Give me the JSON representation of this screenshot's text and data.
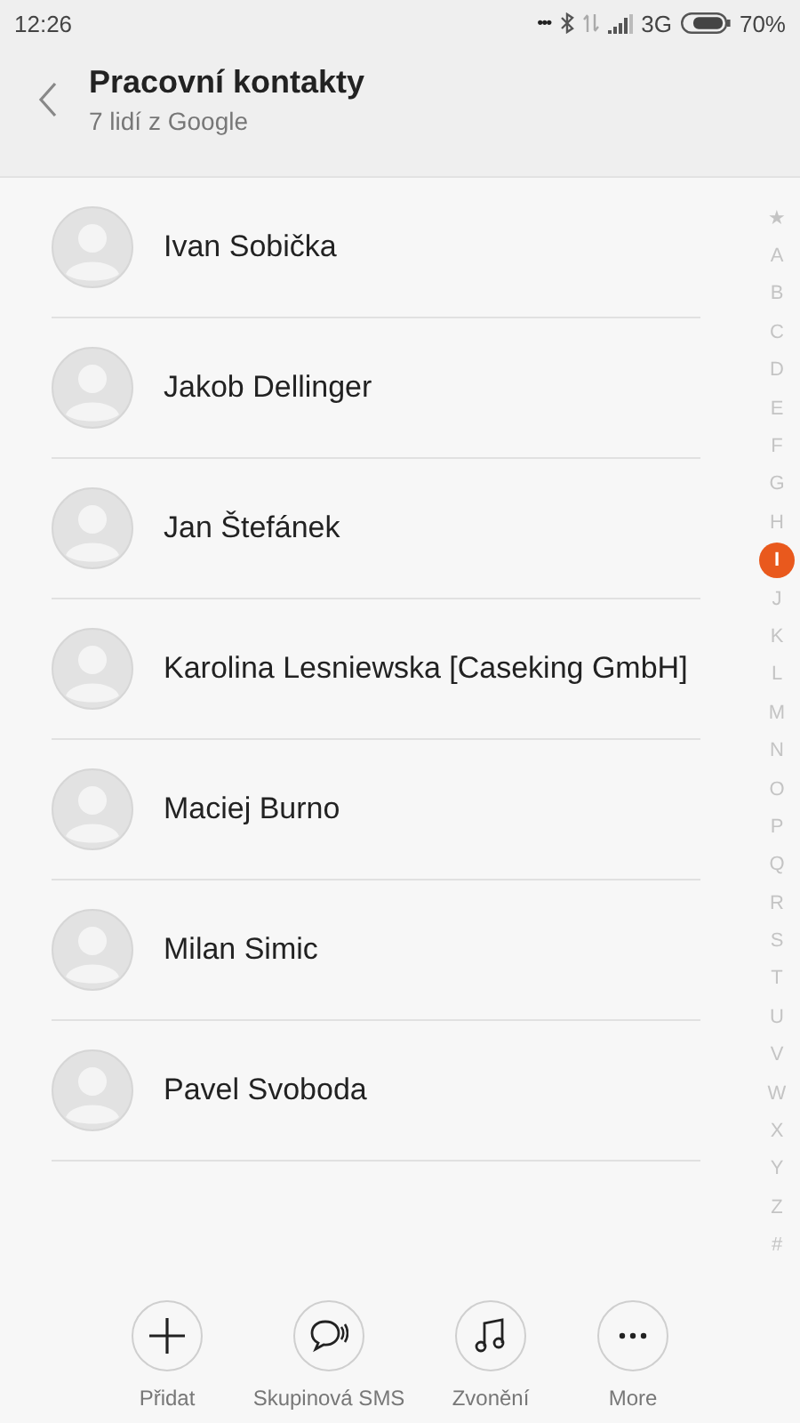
{
  "status_bar": {
    "time": "12:26",
    "dots": "•••",
    "network": "3G",
    "battery": "70%"
  },
  "header": {
    "title": "Pracovní kontakty",
    "subtitle": "7 lidí z Google"
  },
  "contacts": [
    {
      "name": "Ivan Sobička"
    },
    {
      "name": "Jakob Dellinger"
    },
    {
      "name": "Jan Štefánek"
    },
    {
      "name": "Karolina Lesniewska [Caseking GmbH]"
    },
    {
      "name": "Maciej Burno"
    },
    {
      "name": "Milan Simic"
    },
    {
      "name": "Pavel Svoboda"
    }
  ],
  "index": [
    {
      "label": "★",
      "selected": false
    },
    {
      "label": "A",
      "selected": false
    },
    {
      "label": "B",
      "selected": false
    },
    {
      "label": "C",
      "selected": false
    },
    {
      "label": "D",
      "selected": false
    },
    {
      "label": "E",
      "selected": false
    },
    {
      "label": "F",
      "selected": false
    },
    {
      "label": "G",
      "selected": false
    },
    {
      "label": "H",
      "selected": false
    },
    {
      "label": "I",
      "selected": true
    },
    {
      "label": "J",
      "selected": false
    },
    {
      "label": "K",
      "selected": false
    },
    {
      "label": "L",
      "selected": false
    },
    {
      "label": "M",
      "selected": false
    },
    {
      "label": "N",
      "selected": false
    },
    {
      "label": "O",
      "selected": false
    },
    {
      "label": "P",
      "selected": false
    },
    {
      "label": "Q",
      "selected": false
    },
    {
      "label": "R",
      "selected": false
    },
    {
      "label": "S",
      "selected": false
    },
    {
      "label": "T",
      "selected": false
    },
    {
      "label": "U",
      "selected": false
    },
    {
      "label": "V",
      "selected": false
    },
    {
      "label": "W",
      "selected": false
    },
    {
      "label": "X",
      "selected": false
    },
    {
      "label": "Y",
      "selected": false
    },
    {
      "label": "Z",
      "selected": false
    },
    {
      "label": "#",
      "selected": false
    }
  ],
  "actions": [
    {
      "kind": "add",
      "label": "Přidat"
    },
    {
      "kind": "sms",
      "label": "Skupinová SMS"
    },
    {
      "kind": "ringtone",
      "label": "Zvonění"
    },
    {
      "kind": "more",
      "label": "More"
    }
  ]
}
